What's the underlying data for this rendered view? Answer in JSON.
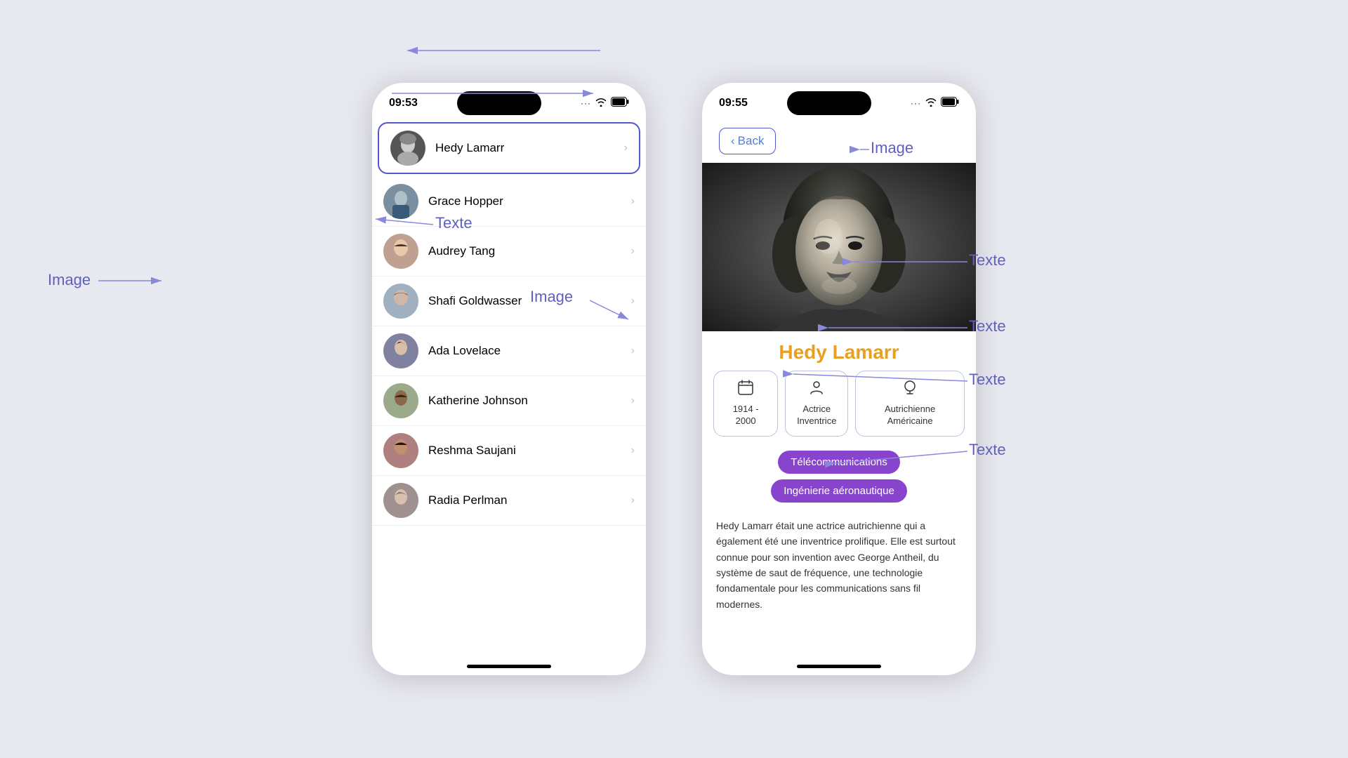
{
  "left_phone": {
    "time": "09:53",
    "people": [
      {
        "id": "hedy",
        "name": "Hedy Lamarr",
        "selected": true
      },
      {
        "id": "grace",
        "name": "Grace Hopper",
        "selected": false
      },
      {
        "id": "audrey",
        "name": "Audrey Tang",
        "selected": false
      },
      {
        "id": "shafi",
        "name": "Shafi Goldwasser",
        "selected": false
      },
      {
        "id": "ada",
        "name": "Ada Lovelace",
        "selected": false
      },
      {
        "id": "katherine",
        "name": "Katherine Johnson",
        "selected": false
      },
      {
        "id": "reshma",
        "name": "Reshma Saujani",
        "selected": false
      },
      {
        "id": "radia",
        "name": "Radia Perlman",
        "selected": false
      }
    ]
  },
  "right_phone": {
    "time": "09:55",
    "back_label": "Back",
    "person_name": "Hedy Lamarr",
    "dates": "1914 - 2000",
    "role1": "Actrice",
    "role2": "Inventrice",
    "nationality": "Autrichienne Américaine",
    "tag1": "Télécommunications",
    "tag2": "Ingénierie aéronautique",
    "description": "Hedy Lamarr était une actrice autrichienne qui a également été une inventrice prolifique. Elle est surtout connue pour son invention avec George Antheil, du système de saut de fréquence, une technologie fondamentale pour les communications sans fil modernes."
  },
  "annotations": {
    "image_label": "Image",
    "texte_label": "Texte"
  }
}
